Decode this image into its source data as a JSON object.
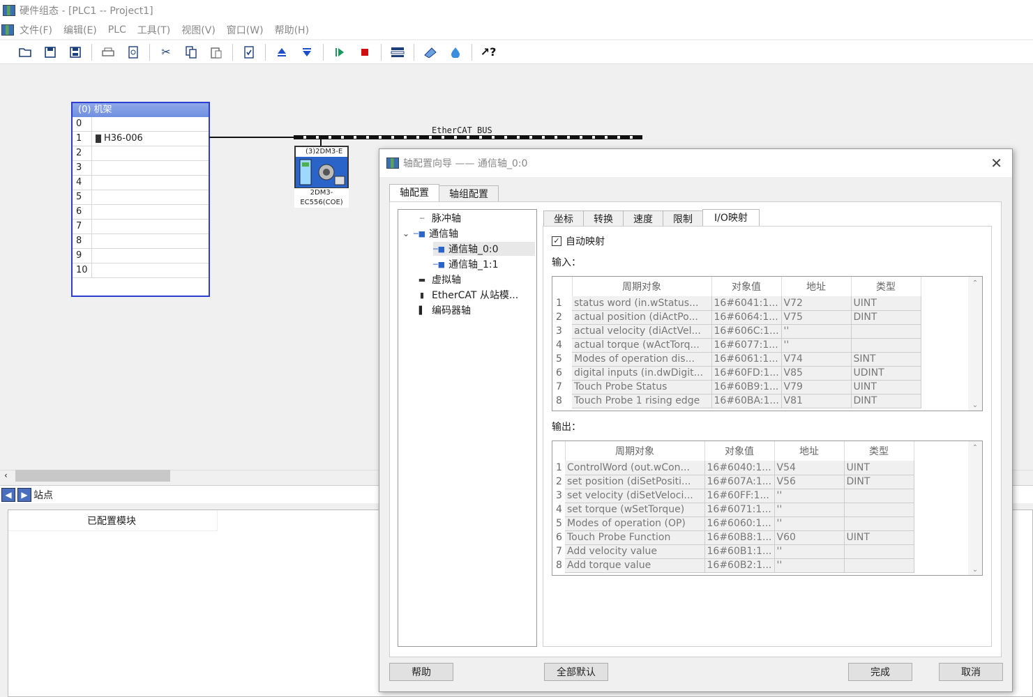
{
  "window": {
    "title": "硬件组态 - [PLC1 -- Project1]"
  },
  "menu": [
    "文件(F)",
    "编辑(E)",
    "PLC",
    "工具(T)",
    "视图(V)",
    "窗口(W)",
    "帮助(H)"
  ],
  "toolbar_icons": [
    "open-icon",
    "save-icon",
    "save-all-icon",
    "print-icon",
    "print-preview-icon",
    "cut-icon",
    "copy-icon",
    "paste-icon",
    "check-icon",
    "upload-icon",
    "download-icon",
    "run-icon",
    "stop-icon",
    "network-icon",
    "config-icon",
    "monitor-icon",
    "context-help-icon"
  ],
  "rack": {
    "header": "(0)  机架",
    "rows": [
      {
        "n": "0",
        "m": ""
      },
      {
        "n": "1",
        "m": "H36-006"
      },
      {
        "n": "2",
        "m": ""
      },
      {
        "n": "3",
        "m": ""
      },
      {
        "n": "4",
        "m": ""
      },
      {
        "n": "5",
        "m": ""
      },
      {
        "n": "6",
        "m": ""
      },
      {
        "n": "7",
        "m": ""
      },
      {
        "n": "8",
        "m": ""
      },
      {
        "n": "9",
        "m": ""
      },
      {
        "n": "10",
        "m": ""
      }
    ]
  },
  "bus": {
    "label": "EtherCAT BUS"
  },
  "drive": {
    "title": "(3)2DM3-E",
    "label_line1": "2DM3-",
    "label_line2": "EC556(COE)"
  },
  "station": {
    "label": "站点",
    "column": "已配置模块"
  },
  "dialog": {
    "title": "轴配置向导 —— 通信轴_0:0",
    "tabs": [
      "轴配置",
      "轴组配置"
    ],
    "tree": [
      "脉冲轴",
      "通信轴",
      "通信轴_0:0",
      "通信轴_1:1",
      "虚拟轴",
      "EtherCAT 从站模...",
      "编码器轴"
    ],
    "subtabs": [
      "坐标",
      "转换",
      "速度",
      "限制",
      "I/O映射"
    ],
    "auto_map": "自动映射",
    "input_label": "输入：",
    "output_label": "输出：",
    "columns": [
      "周期对象",
      "对象值",
      "地址",
      "类型"
    ],
    "inputs": [
      [
        "1",
        "status word (in.wStatus...",
        "16#6041:1...",
        "V72",
        "UINT"
      ],
      [
        "2",
        "actual position (diActPo...",
        "16#6064:1...",
        "V75",
        "DINT"
      ],
      [
        "3",
        "actual velocity (diActVel...",
        "16#606C:1...",
        "''",
        ""
      ],
      [
        "4",
        "actual torque (wActTorq...",
        "16#6077:1...",
        "''",
        ""
      ],
      [
        "5",
        "Modes of operation dis...",
        "16#6061:1...",
        "V74",
        "SINT"
      ],
      [
        "6",
        "digital inputs (in.dwDigit...",
        "16#60FD:1...",
        "V85",
        "UDINT"
      ],
      [
        "7",
        "Touch Probe Status",
        "16#60B9:1...",
        "V79",
        "UINT"
      ],
      [
        "8",
        "Touch Probe 1 rising edge",
        "16#60BA:1...",
        "V81",
        "DINT"
      ]
    ],
    "outputs": [
      [
        "1",
        "ControlWord (out.wCon...",
        "16#6040:1...",
        "V54",
        "UINT"
      ],
      [
        "2",
        "set position (diSetPositi...",
        "16#607A:1...",
        "V56",
        "DINT"
      ],
      [
        "3",
        "set velocity (diSetVeloci...",
        "16#60FF:1...",
        "''",
        ""
      ],
      [
        "4",
        "set torque (wSetTorque)",
        "16#6071:1...",
        "''",
        ""
      ],
      [
        "5",
        "Modes of operation (OP)",
        "16#6060:1...",
        "''",
        ""
      ],
      [
        "6",
        "Touch Probe Function",
        "16#60B8:1...",
        "V60",
        "UINT"
      ],
      [
        "7",
        "Add velocity value",
        "16#60B1:1...",
        "''",
        ""
      ],
      [
        "8",
        "Add torque value",
        "16#60B2:1...",
        "''",
        ""
      ]
    ],
    "buttons": {
      "help": "帮助",
      "defaults": "全部默认",
      "finish": "完成",
      "cancel": "取消"
    }
  }
}
